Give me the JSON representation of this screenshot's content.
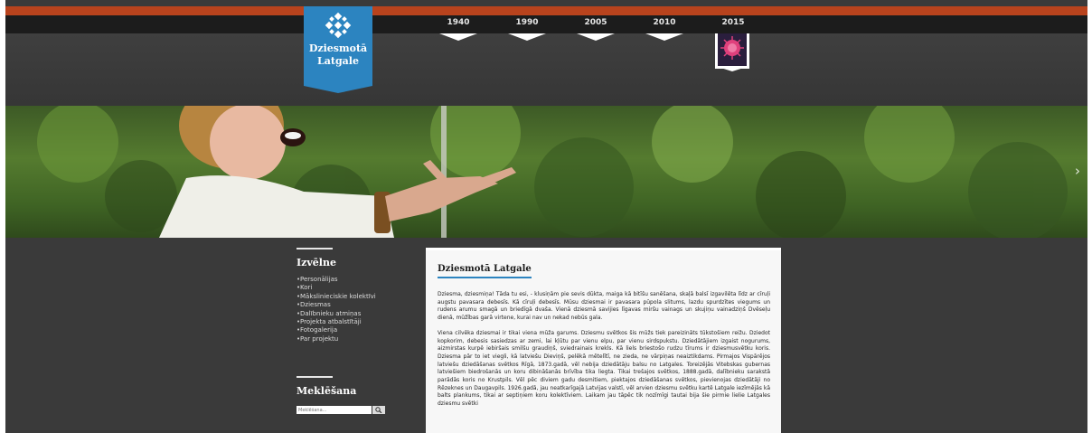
{
  "logo": {
    "title": "Dziesmotā Latgale"
  },
  "timeline": [
    {
      "year": "1940"
    },
    {
      "year": "1990"
    },
    {
      "year": "2005"
    },
    {
      "year": "2010"
    },
    {
      "year": "2015"
    }
  ],
  "slider": {
    "next_icon": "›",
    "slides": 4,
    "active": 0
  },
  "sidebar": {
    "menu_title": "Izvēlne",
    "menu_items": [
      "Personālijas",
      "Kori",
      "Mākslinieciskie kolektīvi",
      "Dziesmas",
      "Dalībnieku atmiņas",
      "Projekta atbalstītāji",
      "Fotogalerija",
      "Par projektu"
    ],
    "search_title": "Meklēšana",
    "search_placeholder": "Meklēšana...",
    "search_icon": "magnifier-icon"
  },
  "article": {
    "title": "Dziesmotā Latgale",
    "paragraphs": [
      "Dziesma, dziesmiņa! Tāda tu esi, - klusiņām pie sevis dūkta, maiga kā bitīšu sanēšana, skaļā balsī izgavilēta līdz ar cīruļi augstu pavasara debesīs. Kā cīruļi debesīs. Mūsu dziesmai ir pavasara pūpola slitums, lazdu spurdzītes viegums un rudens arumu smagā un briedīgā dvaša. Vienā dziesmā savijies līgavas miršu vainags un skujiņu vainadziņš Dvēseļu dienā, mūžības garā virtene, kurai nav un nekad nebūs gala.",
      "Viena cilvēka dziesmai ir tikai viena mūža garums. Dziesmu svētkos šis mūžs tiek pareizināts tūkstošiem reižu. Dziedot kopkorim, debesis sasiedzas ar zemi, lai kļūtu par vienu elpu, par vienu sirdspukstu. Dziedātājiem izgaist nogurums, aizmirstas kurpē iebiršais smilšu graudiņš, sviedrainais krekls. Kā liels briestošo rudzu tīrums ir dziesmusvētku koris. Dziesma pār to iet viegli, kā latviešu Dieviņš, pelēkā mētelītī, ne zieda, ne vārpiņas neaiztikdams. Pirmajos Vispārējos latviešu dziedāšanas svētkos Rīgā, 1873.gadā, vēl nebija dziedātāju balsu no Latgales. Toreizējās Vitebskas gubernas latviešiem biedrošanās un koru dibināšanās brīvība tika liegta. Tikai trešajos svētkos, 1888.gadā, dalībnieku sarakstā parādās koris no Krustpils. Vēl pēc diviem gadu desmitiem, piektajos dziedāšanas svētkos, pievienojas dziedātāji no Rēzeknes un Daugavpils. 1926.gadā, jau neatkarīgajā Latvijas valstī, vēl arvien dziesmu svētku kartē Latgale iezīmējās kā balts plankums, tikai ar septiņiem koru kolektīviem. Laikam jau tāpēc tik nozīmīgi tautai bija šie pirmie lielie Latgales dziesmu svētki"
    ]
  },
  "colors": {
    "accent_blue": "#2c84c0",
    "top_stripe": "#b8431d",
    "background": "#3a3a3a"
  }
}
